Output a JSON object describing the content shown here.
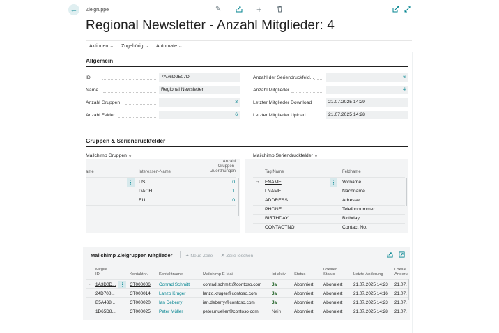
{
  "header": {
    "breadcrumb": "Zielgruppe",
    "title": "Regional Newsletter - Anzahl Mitglieder: 4"
  },
  "actions": {
    "aktionen": "Aktionen",
    "zugehoerig": "Zugehörig",
    "automate": "Automate"
  },
  "allgemein": {
    "title": "Allgemein",
    "left": [
      {
        "label": "ID",
        "value": "7A76D2507D"
      },
      {
        "label": "Name",
        "value": "Regional Newsletter"
      },
      {
        "label": "Anzahl Gruppen",
        "value": "3"
      },
      {
        "label": "Anzahl Felder",
        "value": "6"
      }
    ],
    "right": [
      {
        "label": "Anzahl der Seriendruckfeld...",
        "value": "6"
      },
      {
        "label": "Anzahl Mitglieder",
        "value": "4"
      },
      {
        "label": "Letzter Mitglieder Download",
        "value": "21.07.2025 14:29"
      },
      {
        "label": "Letzter Mitglieder Upload",
        "value": "21.07.2025 14:28"
      }
    ]
  },
  "gruppen": {
    "title": "Gruppen & Seriendruckfelder",
    "groups_label": "Mailchimp Gruppen",
    "groups_cols": {
      "name": "ame",
      "interest": "Interessen-Name",
      "count": "Anzahl Gruppen-Zuordnungen"
    },
    "groups_rows": [
      {
        "interest": "US",
        "count": "0"
      },
      {
        "interest": "DACH",
        "count": "1"
      },
      {
        "interest": "EU",
        "count": "0"
      }
    ],
    "fields_label": "Mailchimp Seriendruckfelder",
    "fields_cols": {
      "tag": "Tag Name",
      "field": "Feldname"
    },
    "fields_rows": [
      {
        "tag": "FNAME",
        "field": "Vorname"
      },
      {
        "tag": "LNAME",
        "field": "Nachname"
      },
      {
        "tag": "ADDRESS",
        "field": "Adresse"
      },
      {
        "tag": "PHONE",
        "field": "Telefonnummer"
      },
      {
        "tag": "BIRTHDAY",
        "field": "Birthday"
      },
      {
        "tag": "CONTACTNO",
        "field": "Contact No."
      }
    ]
  },
  "members": {
    "title": "Mailchimp Zielgruppen Mitglieder",
    "new_line": "Neue Zeile",
    "delete_line": "Zeile löschen",
    "cols": {
      "id": "Mitglie... ID",
      "contact_no": "Kontaktnr.",
      "contact_name": "Kontaktname",
      "email": "Mailchimp E-Mail",
      "active": "Ist aktiv",
      "status": "Status",
      "local_status": "Lokaler Status",
      "last_change": "Letzte Änderung",
      "local_change": "Lokale Änderu"
    },
    "rows": [
      {
        "id": "1A3D0D...",
        "contact_no": "CT000006",
        "contact_name": "Conrad Schmitt",
        "email": "conrad.schmitt@contoso.com",
        "active": "Ja",
        "status": "Abonniert",
        "local_status": "Abonniert",
        "last_change": "21.07.2025 14:23",
        "local_change": "21.07."
      },
      {
        "id": "24D708...",
        "contact_no": "CT000014",
        "contact_name": "Lanzo Kruger",
        "email": "lanzo.kruger@contoso.com",
        "active": "Ja",
        "status": "Abonniert",
        "local_status": "Abonniert",
        "last_change": "21.07.2025 14:16",
        "local_change": "21.07."
      },
      {
        "id": "B5A438...",
        "contact_no": "CT000020",
        "contact_name": "Ian Deberry",
        "email": "ian.deberry@contoso.com",
        "active": "Ja",
        "status": "Abonniert",
        "local_status": "Abonniert",
        "last_change": "21.07.2025 14:23",
        "local_change": "21.07."
      },
      {
        "id": "1D65D8...",
        "contact_no": "CT000025",
        "contact_name": "Peter Müller",
        "email": "peter.mueller@contoso.com",
        "active": "Nein",
        "status": "Abonniert",
        "local_status": "Abonniert",
        "last_change": "21.07.2025 14:28",
        "local_change": "21.07."
      }
    ]
  },
  "colors": {
    "accent": "#00838f",
    "panel": "#f3f4f5"
  }
}
